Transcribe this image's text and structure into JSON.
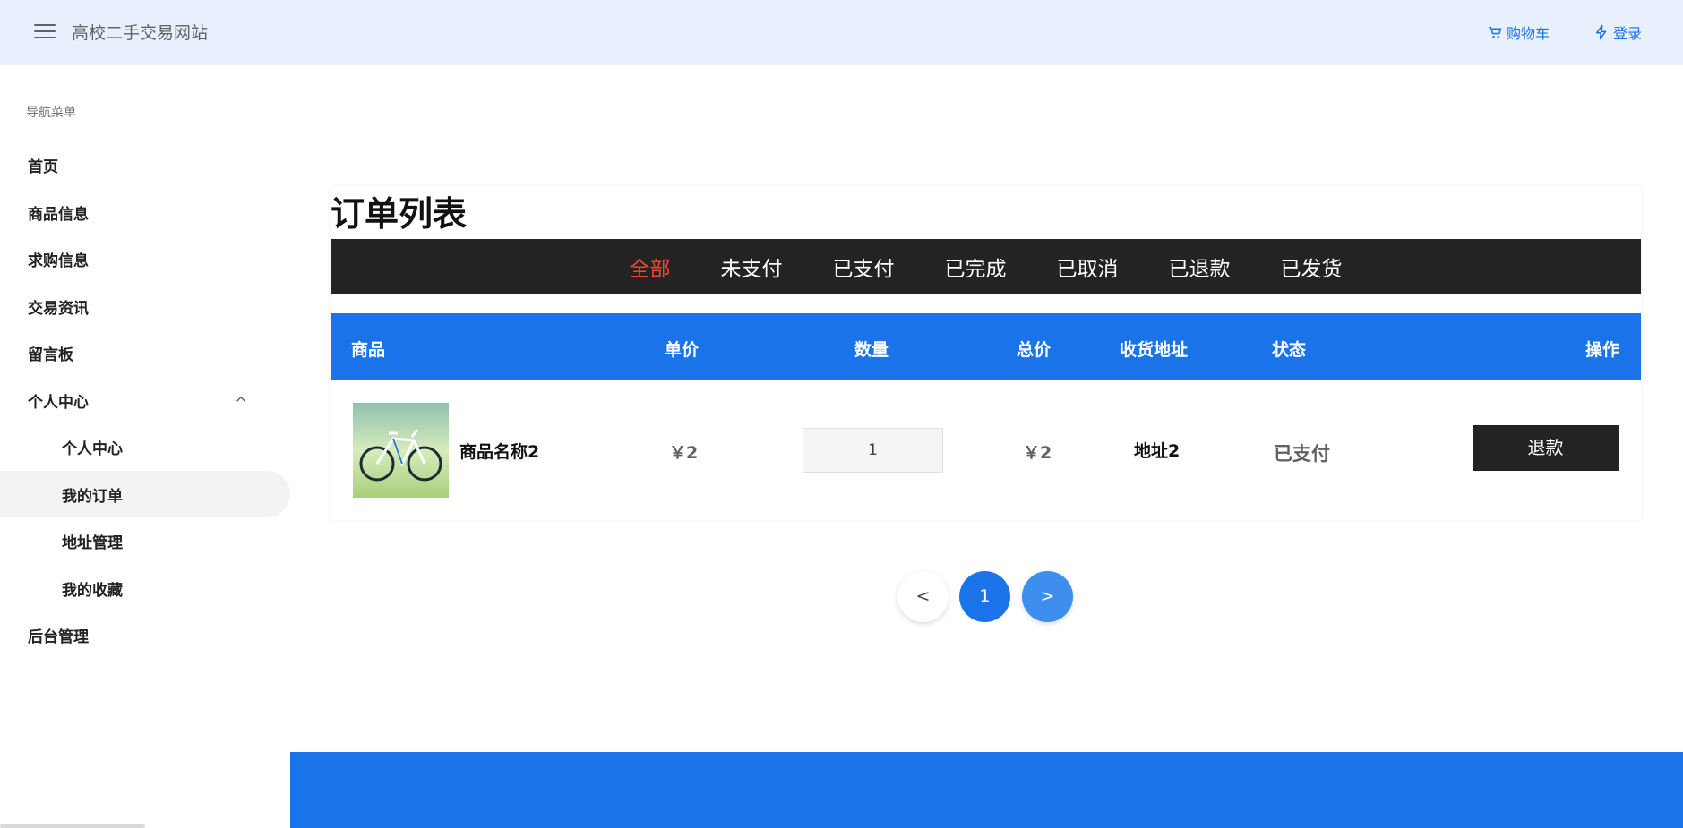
{
  "header": {
    "site_title": "高校二手交易网站",
    "cart_label": "购物车",
    "login_label": "登录",
    "accent_color": "#1a73e8"
  },
  "sidebar": {
    "header": "导航菜单",
    "items": [
      {
        "label": "首页"
      },
      {
        "label": "商品信息"
      },
      {
        "label": "求购信息"
      },
      {
        "label": "交易资讯"
      },
      {
        "label": "留言板"
      },
      {
        "label": "个人中心",
        "expanded": true
      },
      {
        "label": "个人中心",
        "sub": true
      },
      {
        "label": "我的订单",
        "sub": true,
        "active": true
      },
      {
        "label": "地址管理",
        "sub": true
      },
      {
        "label": "我的收藏",
        "sub": true
      },
      {
        "label": "后台管理"
      }
    ]
  },
  "main": {
    "title": "订单列表",
    "tabs": [
      {
        "label": "全部",
        "active": true
      },
      {
        "label": "未支付"
      },
      {
        "label": "已支付"
      },
      {
        "label": "已完成"
      },
      {
        "label": "已取消"
      },
      {
        "label": "已退款"
      },
      {
        "label": "已发货"
      }
    ],
    "columns": {
      "product": "商品",
      "unit_price": "单价",
      "quantity": "数量",
      "total": "总价",
      "address": "收货地址",
      "status": "状态",
      "action": "操作"
    },
    "rows": [
      {
        "image_icon": "bicycle-image",
        "product_name": "商品名称2",
        "unit_price": "￥2",
        "quantity": "1",
        "total": "￥2",
        "address": "地址2",
        "status": "已支付",
        "action_label": "退款"
      }
    ],
    "pagination": {
      "prev": "<",
      "current": "1",
      "next": ">"
    }
  },
  "colors": {
    "tab_bar": "#232323",
    "active_tab": "#f44336",
    "table_header": "#1a73e8",
    "footer": "#1a73e8"
  }
}
